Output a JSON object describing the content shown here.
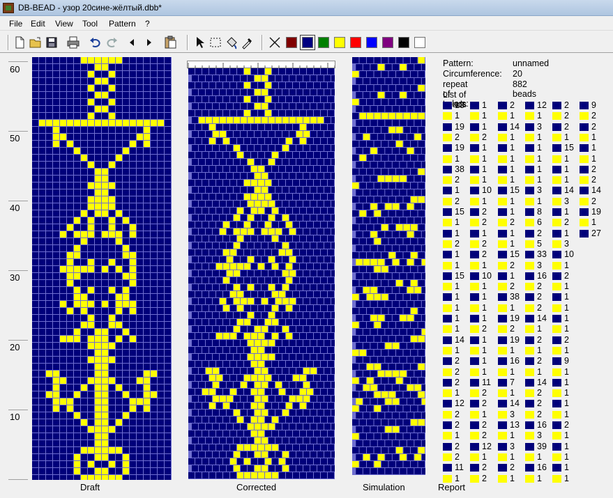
{
  "window": {
    "title": "DB-BEAD - узор 20сине-жёлтый.dbb*"
  },
  "menu": [
    "File",
    "Edit",
    "View",
    "Tool",
    "Pattern",
    "?"
  ],
  "toolbar": {
    "icons": [
      "new-file-icon",
      "open-folder-icon",
      "save-icon",
      "print-icon",
      "undo-icon",
      "redo-icon",
      "arrow-left-icon",
      "arrow-right-icon",
      "paste-icon",
      "pointer-icon",
      "select-rect-icon",
      "fill-icon",
      "eyedropper-icon",
      "clear-icon"
    ],
    "colors": [
      "#800000",
      "#000080",
      "#008000",
      "#ffff00",
      "#ff0000",
      "#0000ff",
      "#800080",
      "#000000",
      "#ffffff"
    ],
    "selected_color_index": 1
  },
  "colors": {
    "bead_blue": "#00007a",
    "bead_yellow": "#ffff00",
    "grid_line": "#6f6fd0"
  },
  "ruler": [
    "60",
    "50",
    "40",
    "30",
    "20",
    "10"
  ],
  "views": [
    "Draft",
    "Corrected",
    "Simulation",
    "Report"
  ],
  "report": {
    "pattern_label": "Pattern:",
    "pattern_value": "unnamed",
    "circ_label": "Circumference:",
    "circ_value": "20",
    "repeat_label": "repeat of colors:",
    "repeat_value": "882 beads",
    "list_label": "List of beads",
    "columns": [
      [
        [
          "b",
          "13"
        ],
        [
          "y",
          "1"
        ],
        [
          "b",
          "19"
        ],
        [
          "y",
          "2"
        ],
        [
          "b",
          "19"
        ],
        [
          "y",
          "1"
        ],
        [
          "b",
          "38"
        ],
        [
          "y",
          "2"
        ],
        [
          "b",
          "1"
        ],
        [
          "y",
          "2"
        ],
        [
          "b",
          "15"
        ],
        [
          "y",
          "1"
        ],
        [
          "b",
          "1"
        ],
        [
          "y",
          "2"
        ],
        [
          "b",
          "1"
        ],
        [
          "y",
          "1"
        ],
        [
          "b",
          "15"
        ],
        [
          "y",
          "1"
        ],
        [
          "b",
          "1"
        ],
        [
          "y",
          "1"
        ],
        [
          "b",
          "1"
        ],
        [
          "y",
          "1"
        ],
        [
          "b",
          "14"
        ],
        [
          "y",
          "1"
        ],
        [
          "b",
          "2"
        ],
        [
          "y",
          "2"
        ],
        [
          "b",
          "2"
        ],
        [
          "y",
          "1"
        ],
        [
          "b",
          "12"
        ],
        [
          "y",
          "2"
        ],
        [
          "b",
          "2"
        ],
        [
          "y",
          "1"
        ],
        [
          "b",
          "2"
        ],
        [
          "y",
          "2"
        ],
        [
          "b",
          "11"
        ],
        [
          "y",
          "1"
        ]
      ],
      [
        [
          "b",
          "1"
        ],
        [
          "y",
          "1"
        ],
        [
          "b",
          "1"
        ],
        [
          "y",
          "2"
        ],
        [
          "b",
          "1"
        ],
        [
          "y",
          "1"
        ],
        [
          "b",
          "1"
        ],
        [
          "y",
          "1"
        ],
        [
          "b",
          "10"
        ],
        [
          "y",
          "1"
        ],
        [
          "b",
          "2"
        ],
        [
          "y",
          "2"
        ],
        [
          "b",
          "1"
        ],
        [
          "y",
          "2"
        ],
        [
          "b",
          "2"
        ],
        [
          "y",
          "1"
        ],
        [
          "b",
          "10"
        ],
        [
          "y",
          "1"
        ],
        [
          "b",
          "1"
        ],
        [
          "y",
          "1"
        ],
        [
          "b",
          "1"
        ],
        [
          "y",
          "2"
        ],
        [
          "b",
          "1"
        ],
        [
          "y",
          "1"
        ],
        [
          "b",
          "1"
        ],
        [
          "y",
          "1"
        ],
        [
          "b",
          "11"
        ],
        [
          "y",
          "2"
        ],
        [
          "b",
          "2"
        ],
        [
          "y",
          "1"
        ],
        [
          "b",
          "2"
        ],
        [
          "y",
          "2"
        ],
        [
          "b",
          "12"
        ],
        [
          "y",
          "1"
        ],
        [
          "b",
          "2"
        ],
        [
          "y",
          "2"
        ]
      ],
      [
        [
          "b",
          "2"
        ],
        [
          "y",
          "1"
        ],
        [
          "b",
          "14"
        ],
        [
          "y",
          "1"
        ],
        [
          "b",
          "1"
        ],
        [
          "y",
          "1"
        ],
        [
          "b",
          "1"
        ],
        [
          "y",
          "1"
        ],
        [
          "b",
          "15"
        ],
        [
          "y",
          "1"
        ],
        [
          "b",
          "1"
        ],
        [
          "y",
          "2"
        ],
        [
          "b",
          "1"
        ],
        [
          "y",
          "1"
        ],
        [
          "b",
          "15"
        ],
        [
          "y",
          "2"
        ],
        [
          "b",
          "1"
        ],
        [
          "y",
          "2"
        ],
        [
          "b",
          "38"
        ],
        [
          "y",
          "1"
        ],
        [
          "b",
          "19"
        ],
        [
          "y",
          "2"
        ],
        [
          "b",
          "19"
        ],
        [
          "y",
          "1"
        ],
        [
          "b",
          "16"
        ],
        [
          "y",
          "1"
        ],
        [
          "b",
          "7"
        ],
        [
          "y",
          "1"
        ],
        [
          "b",
          "14"
        ],
        [
          "y",
          "3"
        ],
        [
          "b",
          "13"
        ],
        [
          "y",
          "1"
        ],
        [
          "b",
          "3"
        ],
        [
          "y",
          "1"
        ],
        [
          "b",
          "2"
        ],
        [
          "y",
          "1"
        ]
      ],
      [
        [
          "b",
          "12"
        ],
        [
          "y",
          "1"
        ],
        [
          "b",
          "3"
        ],
        [
          "y",
          "1"
        ],
        [
          "b",
          "1"
        ],
        [
          "y",
          "1"
        ],
        [
          "b",
          "1"
        ],
        [
          "y",
          "1"
        ],
        [
          "b",
          "3"
        ],
        [
          "y",
          "1"
        ],
        [
          "b",
          "8"
        ],
        [
          "y",
          "6"
        ],
        [
          "b",
          "2"
        ],
        [
          "y",
          "5"
        ],
        [
          "b",
          "33"
        ],
        [
          "y",
          "3"
        ],
        [
          "b",
          "16"
        ],
        [
          "y",
          "2"
        ],
        [
          "b",
          "2"
        ],
        [
          "y",
          "2"
        ],
        [
          "b",
          "14"
        ],
        [
          "y",
          "1"
        ],
        [
          "b",
          "2"
        ],
        [
          "y",
          "1"
        ],
        [
          "b",
          "2"
        ],
        [
          "y",
          "1"
        ],
        [
          "b",
          "14"
        ],
        [
          "y",
          "2"
        ],
        [
          "b",
          "2"
        ],
        [
          "y",
          "2"
        ],
        [
          "b",
          "16"
        ],
        [
          "y",
          "3"
        ],
        [
          "b",
          "39"
        ],
        [
          "y",
          "1"
        ],
        [
          "b",
          "16"
        ],
        [
          "y",
          "1"
        ]
      ],
      [
        [
          "b",
          "2"
        ],
        [
          "y",
          "2"
        ],
        [
          "b",
          "2"
        ],
        [
          "y",
          "1"
        ],
        [
          "b",
          "15"
        ],
        [
          "y",
          "1"
        ],
        [
          "b",
          "1"
        ],
        [
          "y",
          "1"
        ],
        [
          "b",
          "14"
        ],
        [
          "y",
          "3"
        ],
        [
          "b",
          "1"
        ],
        [
          "y",
          "2"
        ],
        [
          "b",
          "1"
        ],
        [
          "y",
          "3"
        ],
        [
          "b",
          "10"
        ],
        [
          "y",
          "1"
        ],
        [
          "b",
          "2"
        ],
        [
          "y",
          "1"
        ],
        [
          "b",
          "1"
        ],
        [
          "y",
          "1"
        ],
        [
          "b",
          "1"
        ],
        [
          "y",
          "1"
        ],
        [
          "b",
          "2"
        ],
        [
          "y",
          "1"
        ],
        [
          "b",
          "9"
        ],
        [
          "y",
          "1"
        ],
        [
          "b",
          "1"
        ],
        [
          "y",
          "1"
        ],
        [
          "b",
          "1"
        ],
        [
          "y",
          "1"
        ],
        [
          "b",
          "2"
        ],
        [
          "y",
          "1"
        ],
        [
          "b",
          "1"
        ],
        [
          "y",
          "1"
        ],
        [
          "b",
          "1"
        ],
        [
          "y",
          "1"
        ]
      ],
      [
        [
          "b",
          "9"
        ],
        [
          "y",
          "2"
        ],
        [
          "b",
          "2"
        ],
        [
          "y",
          "1"
        ],
        [
          "b",
          "1"
        ],
        [
          "y",
          "1"
        ],
        [
          "b",
          "2"
        ],
        [
          "y",
          "2"
        ],
        [
          "b",
          "14"
        ],
        [
          "y",
          "2"
        ],
        [
          "b",
          "19"
        ],
        [
          "y",
          "1"
        ],
        [
          "b",
          "27"
        ]
      ]
    ]
  }
}
